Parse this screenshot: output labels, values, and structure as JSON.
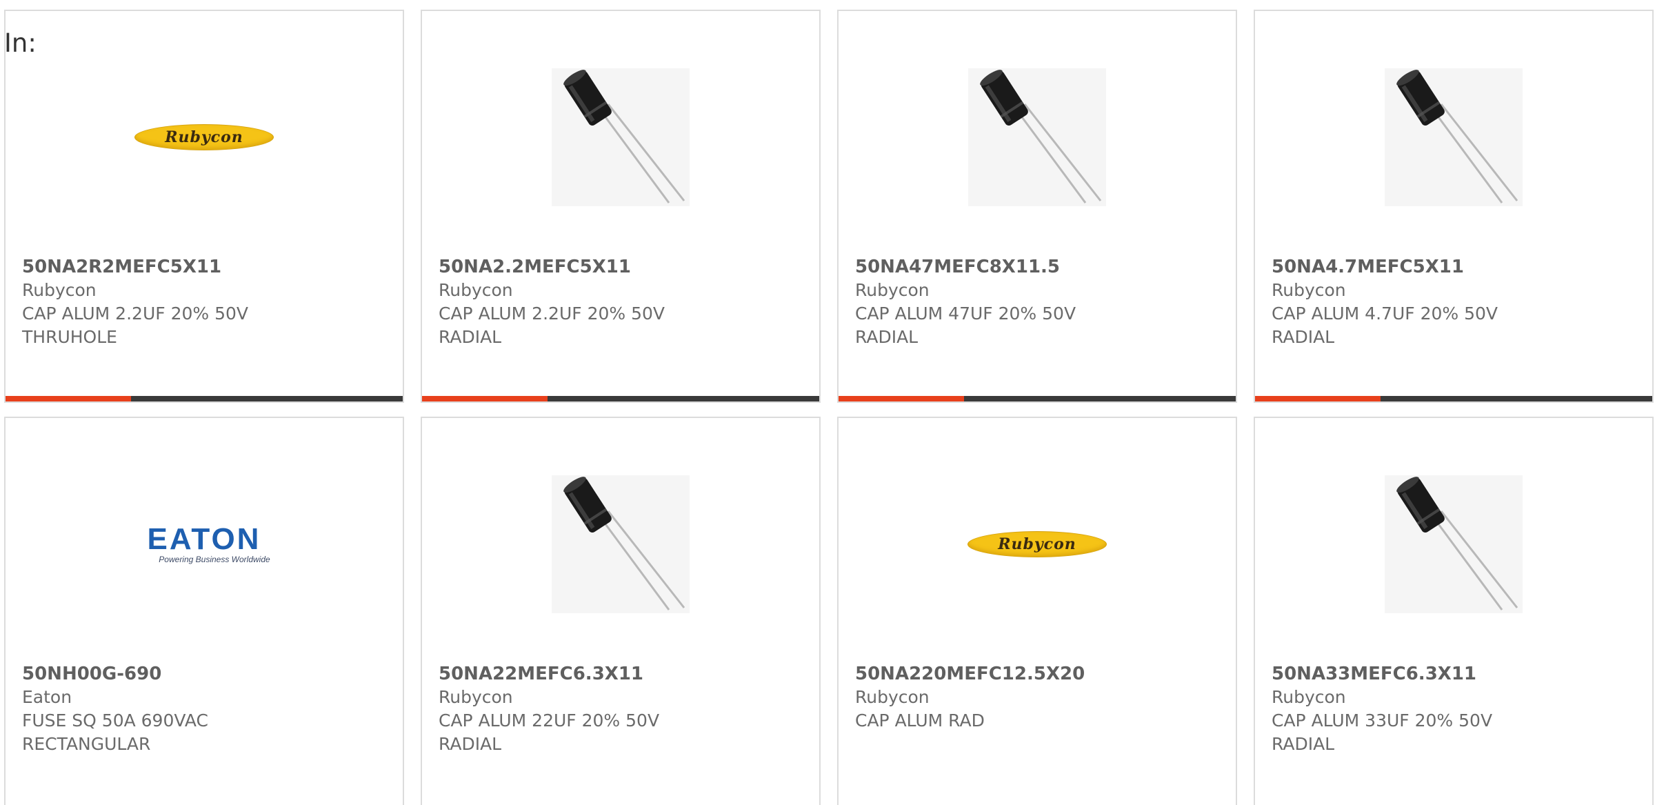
{
  "filter": {
    "label": "In:"
  },
  "products": [
    {
      "part_number": "50NA2R2MEFC5X11",
      "brand": "Rubycon",
      "desc1": "CAP ALUM 2.2UF 20% 50V",
      "desc2": "THRUHOLE",
      "image": "rubycon-logo"
    },
    {
      "part_number": "50NA2.2MEFC5X11",
      "brand": "Rubycon",
      "desc1": "CAP ALUM 2.2UF 20% 50V",
      "desc2": "RADIAL",
      "image": "capacitor-photo"
    },
    {
      "part_number": "50NA47MEFC8X11.5",
      "brand": "Rubycon",
      "desc1": "CAP ALUM 47UF 20% 50V",
      "desc2": "RADIAL",
      "image": "capacitor-photo"
    },
    {
      "part_number": "50NA4.7MEFC5X11",
      "brand": "Rubycon",
      "desc1": "CAP ALUM 4.7UF 20% 50V",
      "desc2": "RADIAL",
      "image": "capacitor-photo"
    },
    {
      "part_number": "50NH00G-690",
      "brand": "Eaton",
      "desc1": "FUSE SQ 50A 690VAC",
      "desc2": "RECTANGULAR",
      "image": "eaton-logo"
    },
    {
      "part_number": "50NA22MEFC6.3X11",
      "brand": "Rubycon",
      "desc1": "CAP ALUM 22UF 20% 50V",
      "desc2": "RADIAL",
      "image": "capacitor-photo"
    },
    {
      "part_number": "50NA220MEFC12.5X20",
      "brand": "Rubycon",
      "desc1": "CAP ALUM RAD",
      "desc2": "",
      "image": "rubycon-logo"
    },
    {
      "part_number": "50NA33MEFC6.3X11",
      "brand": "Rubycon",
      "desc1": "CAP ALUM 33UF 20% 50V",
      "desc2": "RADIAL",
      "image": "capacitor-photo"
    }
  ],
  "logos": {
    "rubycon": "Rubycon",
    "eaton": "EATON",
    "eaton_tagline": "Powering Business Worldwide"
  },
  "colors": {
    "accent": "#e8401c",
    "bar": "#3a3a3a",
    "border": "#dcdcdc",
    "rubycon_yellow": "#f5c316",
    "eaton_blue": "#1e5fb0"
  }
}
